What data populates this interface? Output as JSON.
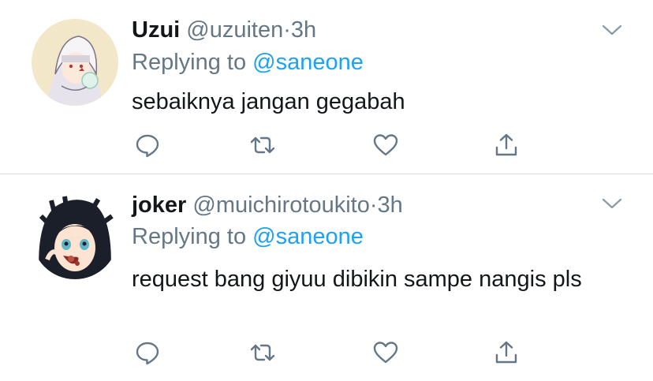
{
  "tweets": [
    {
      "name": "Uzui",
      "handle": "@uzuiten",
      "separator": "·",
      "time": "3h",
      "replying_prefix": "Replying to",
      "replying_to": "@saneone",
      "text": "sebaiknya jangan gegabah",
      "avatar_icon": "avatar-image"
    },
    {
      "name": "joker",
      "handle": "@muichirotoukito",
      "separator": "·",
      "time": "3h",
      "replying_prefix": "Replying to",
      "replying_to": "@saneone",
      "text": "request bang giyuu dibikin sampe nangis pls",
      "avatar_icon": "avatar-image"
    }
  ],
  "icons": {
    "more": "chevron-down-icon",
    "reply": "comment-icon",
    "retweet": "retweet-icon",
    "like": "heart-icon",
    "share": "share-icon"
  },
  "colors": {
    "text": "#14171a",
    "secondary": "#657786",
    "link": "#1da1f2",
    "divider": "#d7dde2"
  }
}
